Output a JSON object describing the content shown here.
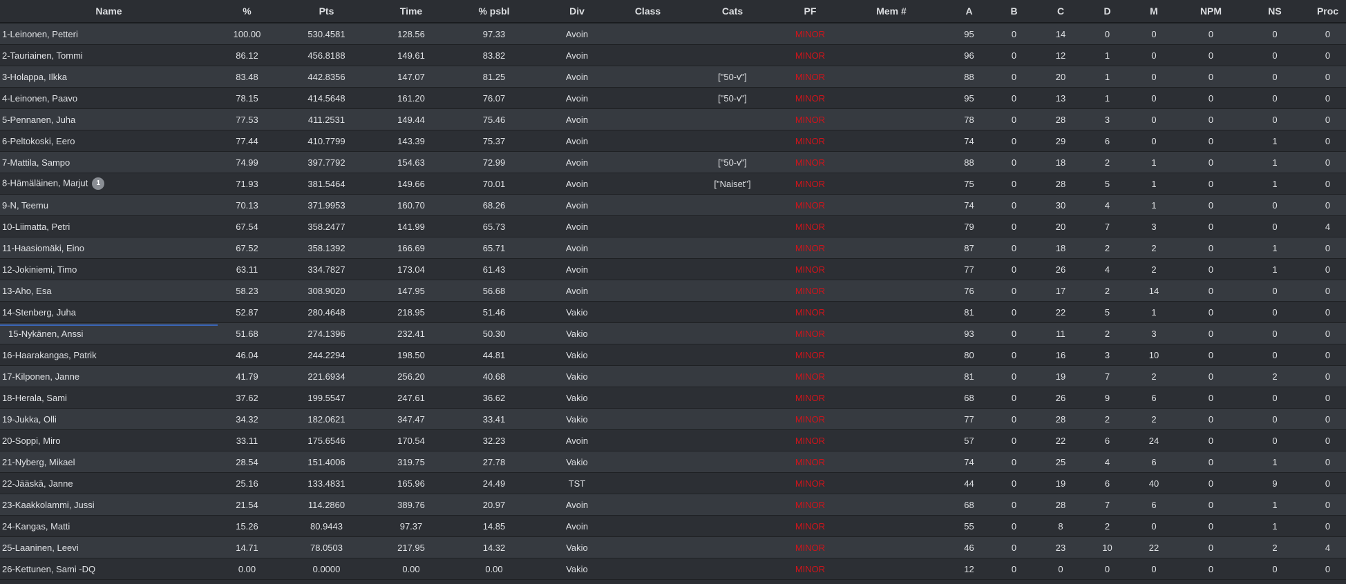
{
  "columns": [
    "Name",
    "%",
    "Pts",
    "Time",
    "% psbl",
    "Div",
    "Class",
    "Cats",
    "PF",
    "Mem #",
    "A",
    "B",
    "C",
    "D",
    "M",
    "NPM",
    "NS",
    "Proc"
  ],
  "rows": [
    {
      "name": "1-Leinonen, Petteri",
      "badge": "",
      "pct": "100.00",
      "pts": "530.4581",
      "time": "128.56",
      "psbl": "97.33",
      "div": "Avoin",
      "class": "",
      "cats": "",
      "pf": "MINOR",
      "mem": "",
      "a": "95",
      "b": "0",
      "c": "14",
      "d": "0",
      "m": "0",
      "npm": "0",
      "ns": "0",
      "proc": "0"
    },
    {
      "name": "2-Tauriainen, Tommi",
      "badge": "",
      "pct": "86.12",
      "pts": "456.8188",
      "time": "149.61",
      "psbl": "83.82",
      "div": "Avoin",
      "class": "",
      "cats": "",
      "pf": "MINOR",
      "mem": "",
      "a": "96",
      "b": "0",
      "c": "12",
      "d": "1",
      "m": "0",
      "npm": "0",
      "ns": "0",
      "proc": "0"
    },
    {
      "name": "3-Holappa, Ilkka",
      "badge": "",
      "pct": "83.48",
      "pts": "442.8356",
      "time": "147.07",
      "psbl": "81.25",
      "div": "Avoin",
      "class": "",
      "cats": "[\"50-v\"]",
      "pf": "MINOR",
      "mem": "",
      "a": "88",
      "b": "0",
      "c": "20",
      "d": "1",
      "m": "0",
      "npm": "0",
      "ns": "0",
      "proc": "0"
    },
    {
      "name": "4-Leinonen, Paavo",
      "badge": "",
      "pct": "78.15",
      "pts": "414.5648",
      "time": "161.20",
      "psbl": "76.07",
      "div": "Avoin",
      "class": "",
      "cats": "[\"50-v\"]",
      "pf": "MINOR",
      "mem": "",
      "a": "95",
      "b": "0",
      "c": "13",
      "d": "1",
      "m": "0",
      "npm": "0",
      "ns": "0",
      "proc": "0"
    },
    {
      "name": "5-Pennanen, Juha",
      "badge": "",
      "pct": "77.53",
      "pts": "411.2531",
      "time": "149.44",
      "psbl": "75.46",
      "div": "Avoin",
      "class": "",
      "cats": "",
      "pf": "MINOR",
      "mem": "",
      "a": "78",
      "b": "0",
      "c": "28",
      "d": "3",
      "m": "0",
      "npm": "0",
      "ns": "0",
      "proc": "0"
    },
    {
      "name": "6-Peltokoski, Eero",
      "badge": "",
      "pct": "77.44",
      "pts": "410.7799",
      "time": "143.39",
      "psbl": "75.37",
      "div": "Avoin",
      "class": "",
      "cats": "",
      "pf": "MINOR",
      "mem": "",
      "a": "74",
      "b": "0",
      "c": "29",
      "d": "6",
      "m": "0",
      "npm": "0",
      "ns": "1",
      "proc": "0"
    },
    {
      "name": "7-Mattila, Sampo",
      "badge": "",
      "pct": "74.99",
      "pts": "397.7792",
      "time": "154.63",
      "psbl": "72.99",
      "div": "Avoin",
      "class": "",
      "cats": "[\"50-v\"]",
      "pf": "MINOR",
      "mem": "",
      "a": "88",
      "b": "0",
      "c": "18",
      "d": "2",
      "m": "1",
      "npm": "0",
      "ns": "1",
      "proc": "0"
    },
    {
      "name": "8-Hämäläinen, Marjut",
      "badge": "1",
      "pct": "71.93",
      "pts": "381.5464",
      "time": "149.66",
      "psbl": "70.01",
      "div": "Avoin",
      "class": "",
      "cats": "[\"Naiset\"]",
      "pf": "MINOR",
      "mem": "",
      "a": "75",
      "b": "0",
      "c": "28",
      "d": "5",
      "m": "1",
      "npm": "0",
      "ns": "1",
      "proc": "0"
    },
    {
      "name": "9-N, Teemu",
      "badge": "",
      "pct": "70.13",
      "pts": "371.9953",
      "time": "160.70",
      "psbl": "68.26",
      "div": "Avoin",
      "class": "",
      "cats": "",
      "pf": "MINOR",
      "mem": "",
      "a": "74",
      "b": "0",
      "c": "30",
      "d": "4",
      "m": "1",
      "npm": "0",
      "ns": "0",
      "proc": "0"
    },
    {
      "name": "10-Liimatta, Petri",
      "badge": "",
      "pct": "67.54",
      "pts": "358.2477",
      "time": "141.99",
      "psbl": "65.73",
      "div": "Avoin",
      "class": "",
      "cats": "",
      "pf": "MINOR",
      "mem": "",
      "a": "79",
      "b": "0",
      "c": "20",
      "d": "7",
      "m": "3",
      "npm": "0",
      "ns": "0",
      "proc": "4"
    },
    {
      "name": "11-Haasiomäki, Eino",
      "badge": "",
      "pct": "67.52",
      "pts": "358.1392",
      "time": "166.69",
      "psbl": "65.71",
      "div": "Avoin",
      "class": "",
      "cats": "",
      "pf": "MINOR",
      "mem": "",
      "a": "87",
      "b": "0",
      "c": "18",
      "d": "2",
      "m": "2",
      "npm": "0",
      "ns": "1",
      "proc": "0"
    },
    {
      "name": "12-Jokiniemi, Timo",
      "badge": "",
      "pct": "63.11",
      "pts": "334.7827",
      "time": "173.04",
      "psbl": "61.43",
      "div": "Avoin",
      "class": "",
      "cats": "",
      "pf": "MINOR",
      "mem": "",
      "a": "77",
      "b": "0",
      "c": "26",
      "d": "4",
      "m": "2",
      "npm": "0",
      "ns": "1",
      "proc": "0"
    },
    {
      "name": "13-Aho, Esa",
      "badge": "",
      "pct": "58.23",
      "pts": "308.9020",
      "time": "147.95",
      "psbl": "56.68",
      "div": "Avoin",
      "class": "",
      "cats": "",
      "pf": "MINOR",
      "mem": "",
      "a": "76",
      "b": "0",
      "c": "17",
      "d": "2",
      "m": "14",
      "npm": "0",
      "ns": "0",
      "proc": "0"
    },
    {
      "name": "14-Stenberg, Juha",
      "badge": "",
      "pct": "52.87",
      "pts": "280.4648",
      "time": "218.95",
      "psbl": "51.46",
      "div": "Vakio",
      "class": "",
      "cats": "",
      "pf": "MINOR",
      "mem": "",
      "a": "81",
      "b": "0",
      "c": "22",
      "d": "5",
      "m": "1",
      "npm": "0",
      "ns": "0",
      "proc": "0"
    },
    {
      "name": "15-Nykänen, Anssi",
      "badge": "",
      "selected": true,
      "pct": "51.68",
      "pts": "274.1396",
      "time": "232.41",
      "psbl": "50.30",
      "div": "Vakio",
      "class": "",
      "cats": "",
      "pf": "MINOR",
      "mem": "",
      "a": "93",
      "b": "0",
      "c": "11",
      "d": "2",
      "m": "3",
      "npm": "0",
      "ns": "0",
      "proc": "0"
    },
    {
      "name": "16-Haarakangas, Patrik",
      "badge": "",
      "pct": "46.04",
      "pts": "244.2294",
      "time": "198.50",
      "psbl": "44.81",
      "div": "Vakio",
      "class": "",
      "cats": "",
      "pf": "MINOR",
      "mem": "",
      "a": "80",
      "b": "0",
      "c": "16",
      "d": "3",
      "m": "10",
      "npm": "0",
      "ns": "0",
      "proc": "0"
    },
    {
      "name": "17-Kilponen, Janne",
      "badge": "",
      "pct": "41.79",
      "pts": "221.6934",
      "time": "256.20",
      "psbl": "40.68",
      "div": "Vakio",
      "class": "",
      "cats": "",
      "pf": "MINOR",
      "mem": "",
      "a": "81",
      "b": "0",
      "c": "19",
      "d": "7",
      "m": "2",
      "npm": "0",
      "ns": "2",
      "proc": "0"
    },
    {
      "name": "18-Herala, Sami",
      "badge": "",
      "pct": "37.62",
      "pts": "199.5547",
      "time": "247.61",
      "psbl": "36.62",
      "div": "Vakio",
      "class": "",
      "cats": "",
      "pf": "MINOR",
      "mem": "",
      "a": "68",
      "b": "0",
      "c": "26",
      "d": "9",
      "m": "6",
      "npm": "0",
      "ns": "0",
      "proc": "0"
    },
    {
      "name": "19-Jukka, Olli",
      "badge": "",
      "pct": "34.32",
      "pts": "182.0621",
      "time": "347.47",
      "psbl": "33.41",
      "div": "Vakio",
      "class": "",
      "cats": "",
      "pf": "MINOR",
      "mem": "",
      "a": "77",
      "b": "0",
      "c": "28",
      "d": "2",
      "m": "2",
      "npm": "0",
      "ns": "0",
      "proc": "0"
    },
    {
      "name": "20-Soppi, Miro",
      "badge": "",
      "pct": "33.11",
      "pts": "175.6546",
      "time": "170.54",
      "psbl": "32.23",
      "div": "Avoin",
      "class": "",
      "cats": "",
      "pf": "MINOR",
      "mem": "",
      "a": "57",
      "b": "0",
      "c": "22",
      "d": "6",
      "m": "24",
      "npm": "0",
      "ns": "0",
      "proc": "0"
    },
    {
      "name": "21-Nyberg, Mikael",
      "badge": "",
      "pct": "28.54",
      "pts": "151.4006",
      "time": "319.75",
      "psbl": "27.78",
      "div": "Vakio",
      "class": "",
      "cats": "",
      "pf": "MINOR",
      "mem": "",
      "a": "74",
      "b": "0",
      "c": "25",
      "d": "4",
      "m": "6",
      "npm": "0",
      "ns": "1",
      "proc": "0"
    },
    {
      "name": "22-Jääskä, Janne",
      "badge": "",
      "pct": "25.16",
      "pts": "133.4831",
      "time": "165.96",
      "psbl": "24.49",
      "div": "TST",
      "class": "",
      "cats": "",
      "pf": "MINOR",
      "mem": "",
      "a": "44",
      "b": "0",
      "c": "19",
      "d": "6",
      "m": "40",
      "npm": "0",
      "ns": "9",
      "proc": "0"
    },
    {
      "name": "23-Kaakkolammi, Jussi",
      "badge": "",
      "pct": "21.54",
      "pts": "114.2860",
      "time": "389.76",
      "psbl": "20.97",
      "div": "Avoin",
      "class": "",
      "cats": "",
      "pf": "MINOR",
      "mem": "",
      "a": "68",
      "b": "0",
      "c": "28",
      "d": "7",
      "m": "6",
      "npm": "0",
      "ns": "1",
      "proc": "0"
    },
    {
      "name": "24-Kangas, Matti",
      "badge": "",
      "pct": "15.26",
      "pts": "80.9443",
      "time": "97.37",
      "psbl": "14.85",
      "div": "Avoin",
      "class": "",
      "cats": "",
      "pf": "MINOR",
      "mem": "",
      "a": "55",
      "b": "0",
      "c": "8",
      "d": "2",
      "m": "0",
      "npm": "0",
      "ns": "1",
      "proc": "0"
    },
    {
      "name": "25-Laaninen, Leevi",
      "badge": "",
      "pct": "14.71",
      "pts": "78.0503",
      "time": "217.95",
      "psbl": "14.32",
      "div": "Vakio",
      "class": "",
      "cats": "",
      "pf": "MINOR",
      "mem": "",
      "a": "46",
      "b": "0",
      "c": "23",
      "d": "10",
      "m": "22",
      "npm": "0",
      "ns": "2",
      "proc": "4"
    },
    {
      "name": "26-Kettunen, Sami -DQ",
      "badge": "",
      "pct": "0.00",
      "pts": "0.0000",
      "time": "0.00",
      "psbl": "0.00",
      "div": "Vakio",
      "class": "",
      "cats": "",
      "pf": "MINOR",
      "mem": "",
      "a": "12",
      "b": "0",
      "c": "0",
      "d": "0",
      "m": "0",
      "npm": "0",
      "ns": "0",
      "proc": "0"
    }
  ],
  "colors": {
    "background": "#2b2e33",
    "row_odd": "#363a40",
    "row_even": "#2c2f34",
    "pf_text": "#d0141b",
    "selection_line": "#3a66b8"
  }
}
